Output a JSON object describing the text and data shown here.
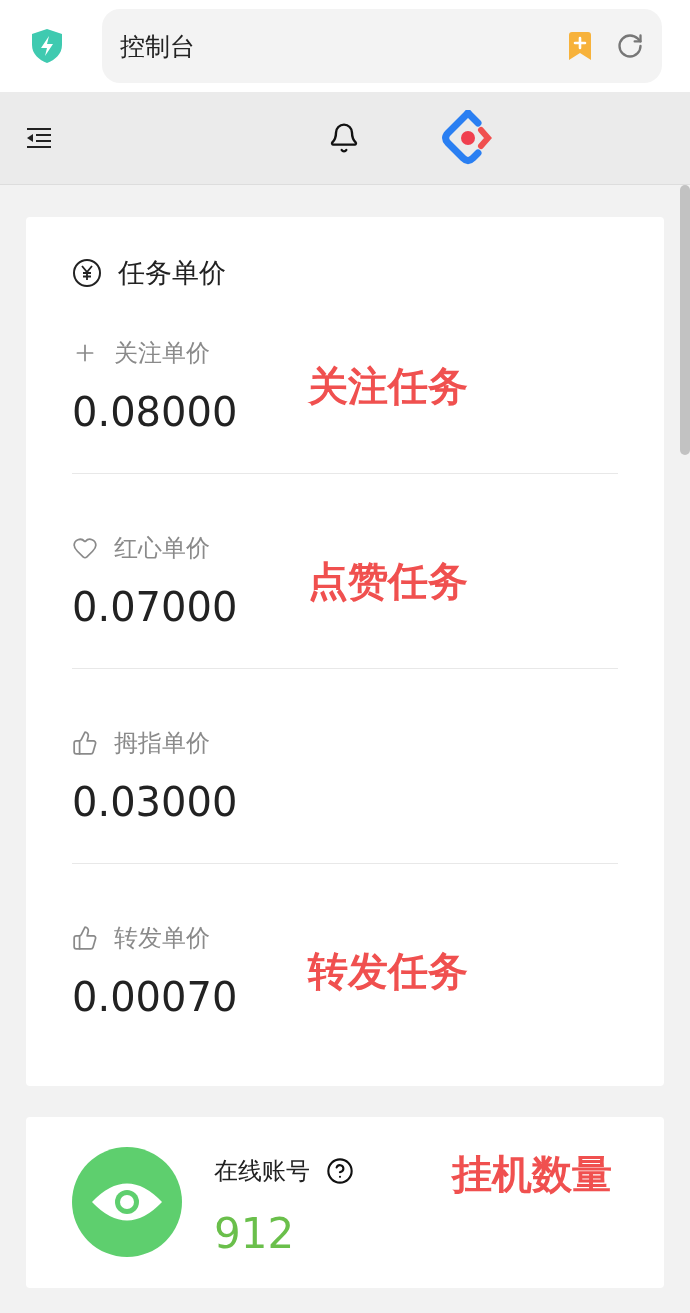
{
  "address_bar": {
    "title": "控制台"
  },
  "price_card": {
    "title": "任务单价",
    "items": [
      {
        "kind": "follow",
        "label": "关注单价",
        "value": "0.08000",
        "annotation": "关注任务"
      },
      {
        "kind": "heart",
        "label": "红心单价",
        "value": "0.07000",
        "annotation": "点赞任务"
      },
      {
        "kind": "thumb",
        "label": "拇指单价",
        "value": "0.03000"
      },
      {
        "kind": "thumb",
        "label": "转发单价",
        "value": "0.00070",
        "annotation": "转发任务"
      }
    ]
  },
  "online_card": {
    "label": "在线账号",
    "value": "912",
    "annotation": "挂机数量"
  }
}
